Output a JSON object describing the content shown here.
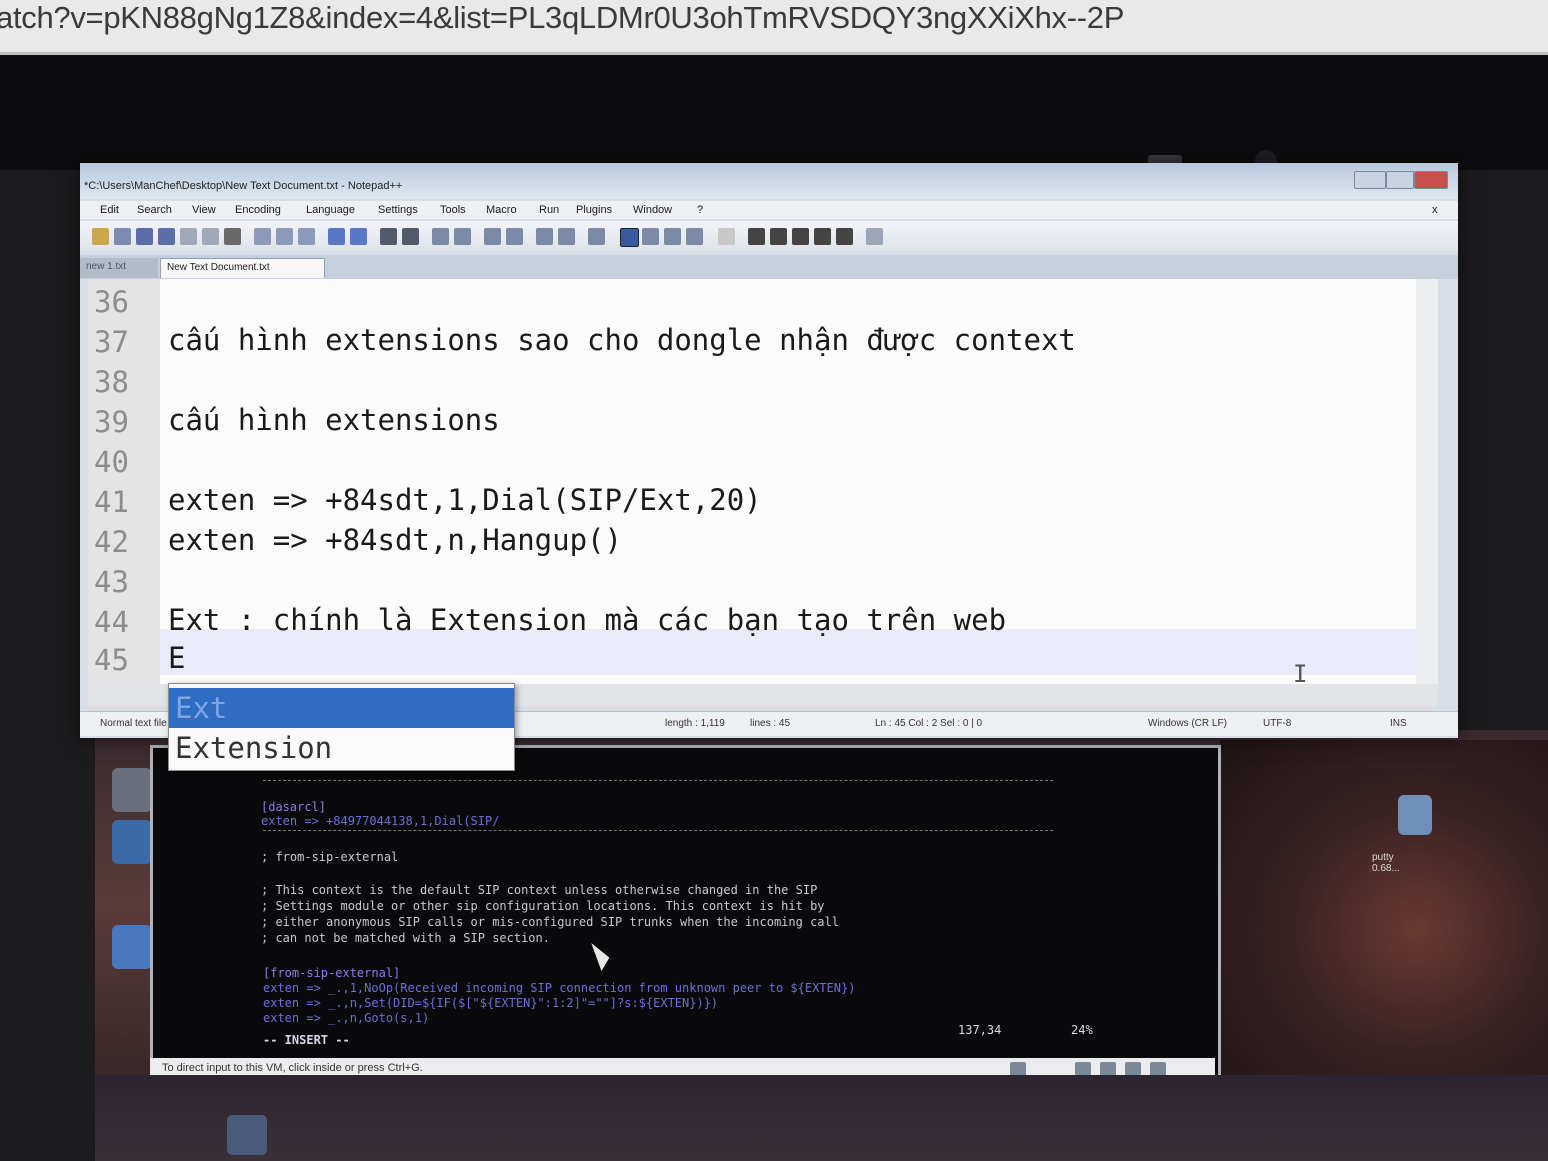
{
  "browser": {
    "url_fragment": "atch?v=pKN88gNg1Z8&index=4&list=PL3qLDMr0U3ohTmRVSDQY3ngXXiXhx--2P"
  },
  "npp": {
    "title": "*C:\\Users\\ManChef\\Desktop\\New Text Document.txt - Notepad++",
    "menu": [
      "Edit",
      "Search",
      "View",
      "Encoding",
      "Language",
      "Settings",
      "Tools",
      "Macro",
      "Run",
      "Plugins",
      "Window",
      "?"
    ],
    "tabs": {
      "inactive": "new 1.txt",
      "active": "New Text Document.txt"
    },
    "lines": [
      {
        "num": "36",
        "text": ""
      },
      {
        "num": "37",
        "text": "cấu hình extensions sao cho dongle nhận được context"
      },
      {
        "num": "38",
        "text": ""
      },
      {
        "num": "39",
        "text": "cấu hình extensions"
      },
      {
        "num": "40",
        "text": ""
      },
      {
        "num": "41",
        "text": "exten => +84sdt,1,Dial(SIP/Ext,20)"
      },
      {
        "num": "42",
        "text": "exten => +84sdt,n,Hangup()"
      },
      {
        "num": "43",
        "text": ""
      },
      {
        "num": "44",
        "text": "Ext : chính là Extension mà các bạn tạo trên web"
      },
      {
        "num": "45",
        "text": "E"
      }
    ],
    "autocomplete": [
      "Ext",
      "Extension"
    ],
    "status": {
      "filetype": "Normal text file",
      "length": "length : 1,119",
      "lines": "lines : 45",
      "position": "Ln : 45    Col : 2    Sel : 0 | 0",
      "eol": "Windows (CR LF)",
      "encoding": "UTF-8",
      "mode": "INS"
    }
  },
  "terminal": {
    "lines": [
      "[dasarcl]",
      "exten => +84977044138,1,Dial(SIP/",
      "; from-sip-external",
      "; This context is the default SIP context unless otherwise changed in the SIP",
      "; Settings module or other sip configuration locations. This context is hit by",
      "; either anonymous SIP calls or mis-configured SIP trunks when the incoming call",
      "; can not be matched with a SIP section.",
      "[from-sip-external]",
      "exten => _.,1,NoOp(Received incoming SIP connection from unknown peer to ${EXTEN})",
      "exten => _.,n,Set(DID=${IF($[\"${EXTEN}\":1:2]\"=\"\"]?s:${EXTEN})})",
      "exten => _.,n,Goto(s,1)",
      "-- INSERT --"
    ],
    "cursor_pos": "137,34",
    "scroll_pct": "24%"
  },
  "vm": {
    "status_text": "To direct input to this VM, click inside or press Ctrl+G."
  },
  "desktop": {
    "icon_label": "putty 0.68..."
  }
}
